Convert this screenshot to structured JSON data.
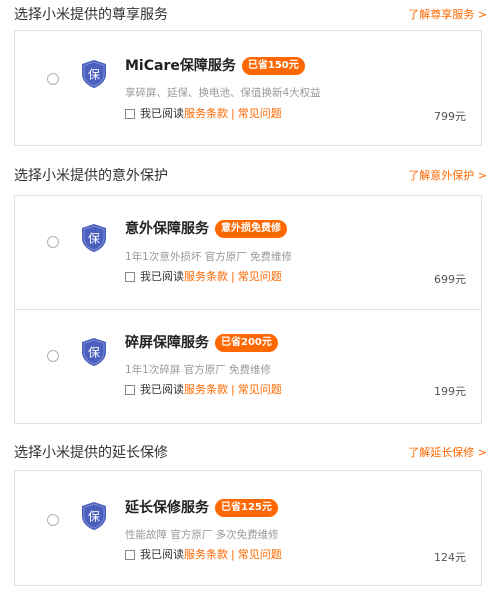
{
  "sections": [
    {
      "title": "选择小米提供的尊享服务",
      "link": "了解尊享服务 >",
      "items": [
        {
          "title": "MiCare保障服务",
          "badge": "已省150元",
          "desc": "享碎屏、延保、换电池、保值换新4大权益",
          "agree_prefix": "我已阅读",
          "terms": "服务条款",
          "separator": "|",
          "faq": "常见问题",
          "price": "799元"
        }
      ]
    },
    {
      "title": "选择小米提供的意外保护",
      "link": "了解意外保护 >",
      "items": [
        {
          "title": "意外保障服务",
          "badge": "意外损免费修",
          "desc": "1年1次意外损坏 官方原厂 免费维修",
          "agree_prefix": "我已阅读",
          "terms": "服务条款",
          "separator": "|",
          "faq": "常见问题",
          "price": "699元"
        },
        {
          "title": "碎屏保障服务",
          "badge": "已省200元",
          "desc": "1年1次碎屏 官方原厂 免费维修",
          "agree_prefix": "我已阅读",
          "terms": "服务条款",
          "separator": "|",
          "faq": "常见问题",
          "price": "199元"
        }
      ]
    },
    {
      "title": "选择小米提供的延长保修",
      "link": "了解延长保修 >",
      "items": [
        {
          "title": "延长保修服务",
          "badge": "已省125元",
          "desc": "性能故障 官方原厂 多次免费维修",
          "agree_prefix": "我已阅读",
          "terms": "服务条款",
          "separator": "|",
          "faq": "常见问题",
          "price": "124元"
        }
      ]
    }
  ],
  "shield_glyph": "保",
  "icon": "shield-icon",
  "colors": {
    "accent": "#ff6700",
    "shield": "#4a5fbe",
    "border": "#e0e0e0"
  }
}
